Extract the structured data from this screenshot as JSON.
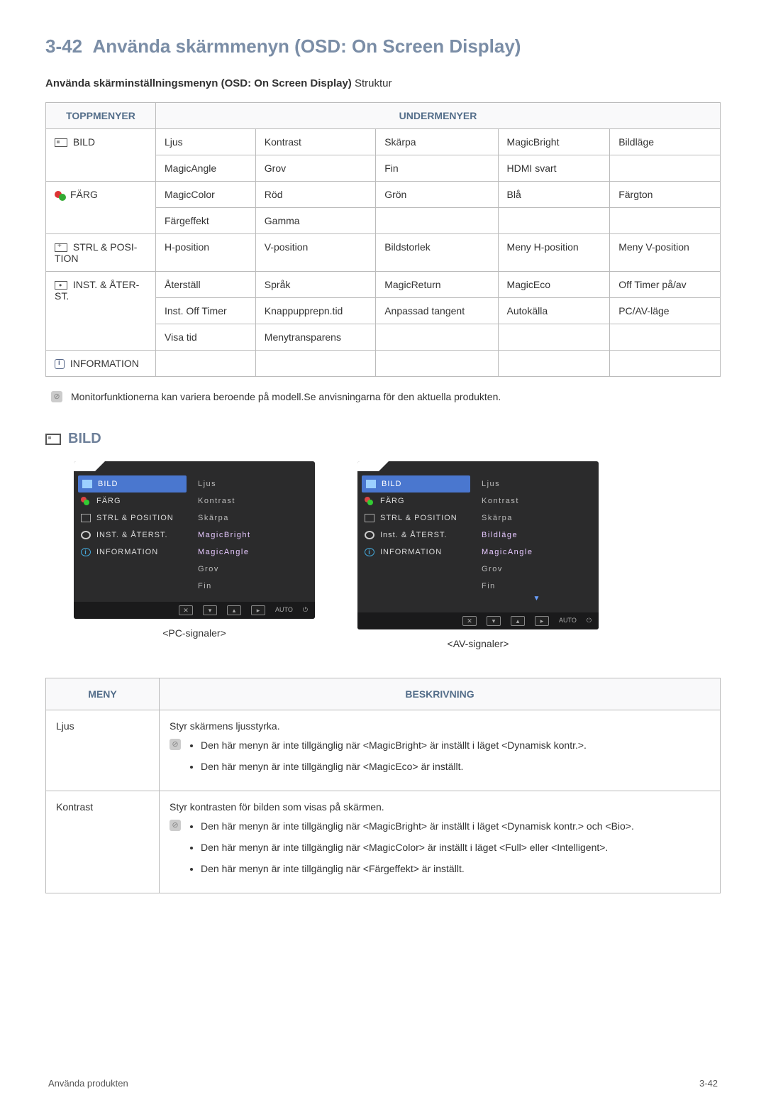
{
  "title_number": "3-42",
  "title_text": "Använda skärmmenyn (OSD: On Screen Display)",
  "subheading_bold": "Använda skärminställningsmenyn (OSD: On Screen Display)",
  "subheading_rest": " Struktur",
  "table_headers": {
    "top": "TOPPMENYER",
    "sub": "UNDERMENYER"
  },
  "top_menus": {
    "bild": "BILD",
    "farg": "FÄRG",
    "strl": "STRL & POSI­TION",
    "inst": "INST. & ÅTER­ST.",
    "info": "INFORMA­TION"
  },
  "rows": {
    "bild": [
      [
        "Ljus",
        "Kontrast",
        "Skärpa",
        "MagicBright",
        "Bildläge"
      ],
      [
        "MagicAngle",
        "Grov",
        "Fin",
        "HDMI svart",
        ""
      ]
    ],
    "farg": [
      [
        "MagicColor",
        "Röd",
        "Grön",
        "Blå",
        "Färgton"
      ],
      [
        "Färgeffekt",
        "Gamma",
        "",
        "",
        ""
      ]
    ],
    "strl": [
      [
        "H-position",
        "V-position",
        "Bildstorlek",
        "Meny H-position",
        "Meny V-position"
      ]
    ],
    "inst": [
      [
        "Återställ",
        "Språk",
        "MagicReturn",
        "MagicEco",
        "Off Timer på/av"
      ],
      [
        "Inst. Off Timer",
        "Knappupprepn.tid",
        "Anpassad tangent",
        "Autokälla",
        "PC/AV-läge"
      ],
      [
        "Visa tid",
        "Menytransparens",
        "",
        "",
        ""
      ]
    ],
    "info": [
      [
        "",
        "",
        "",
        "",
        ""
      ]
    ]
  },
  "note_text": "Monitorfunktionerna kan variera beroende på modell.Se anvisningarna för den aktuella produkten.",
  "section_bild": "BILD",
  "osd": {
    "sidebar": {
      "bild": "BILD",
      "farg": "FÄRG",
      "strl": "STRL & POSITION",
      "inst_pc": "INST. & ÅTERST.",
      "inst_av": "Inst. & ÅTERST.",
      "info": "INFORMATION"
    },
    "pc_items": [
      "Ljus",
      "Kontrast",
      "Skärpa",
      "MagicBright",
      "MagicAngle",
      "Grov",
      "Fin"
    ],
    "av_items": [
      "Ljus",
      "Kontrast",
      "Skärpa",
      "Bildläge",
      "MagicAngle",
      "Grov",
      "Fin"
    ],
    "footer_auto": "AUTO",
    "caption_pc": "<PC-signaler>",
    "caption_av": "<AV-signaler>",
    "arrow": "▼"
  },
  "desc_headers": {
    "meny": "MENY",
    "besk": "BESKRIVNING"
  },
  "desc": {
    "ljus": {
      "name": "Ljus",
      "intro": "Styr skärmens ljusstyrka.",
      "b1": "Den här menyn är inte tillgänglig när <MagicBright> är inställt i läget <Dynamisk kontr.>.",
      "b2": "Den här menyn är inte tillgänglig när <MagicEco> är inställt."
    },
    "kontrast": {
      "name": "Kontrast",
      "intro": "Styr kontrasten för bilden som visas på skärmen.",
      "b1": "Den här menyn är inte tillgänglig när <MagicBright> är inställt i läget <Dynamisk kontr.> och <Bio>.",
      "b2": "Den här menyn är inte tillgänglig när <MagicColor> är inställt i läget <Full> eller <Intelligent>.",
      "b3": "Den här menyn är inte tillgänglig när <Färgeffekt> är inställt."
    }
  },
  "footer": {
    "left": "Använda produkten",
    "right": "3-42"
  }
}
